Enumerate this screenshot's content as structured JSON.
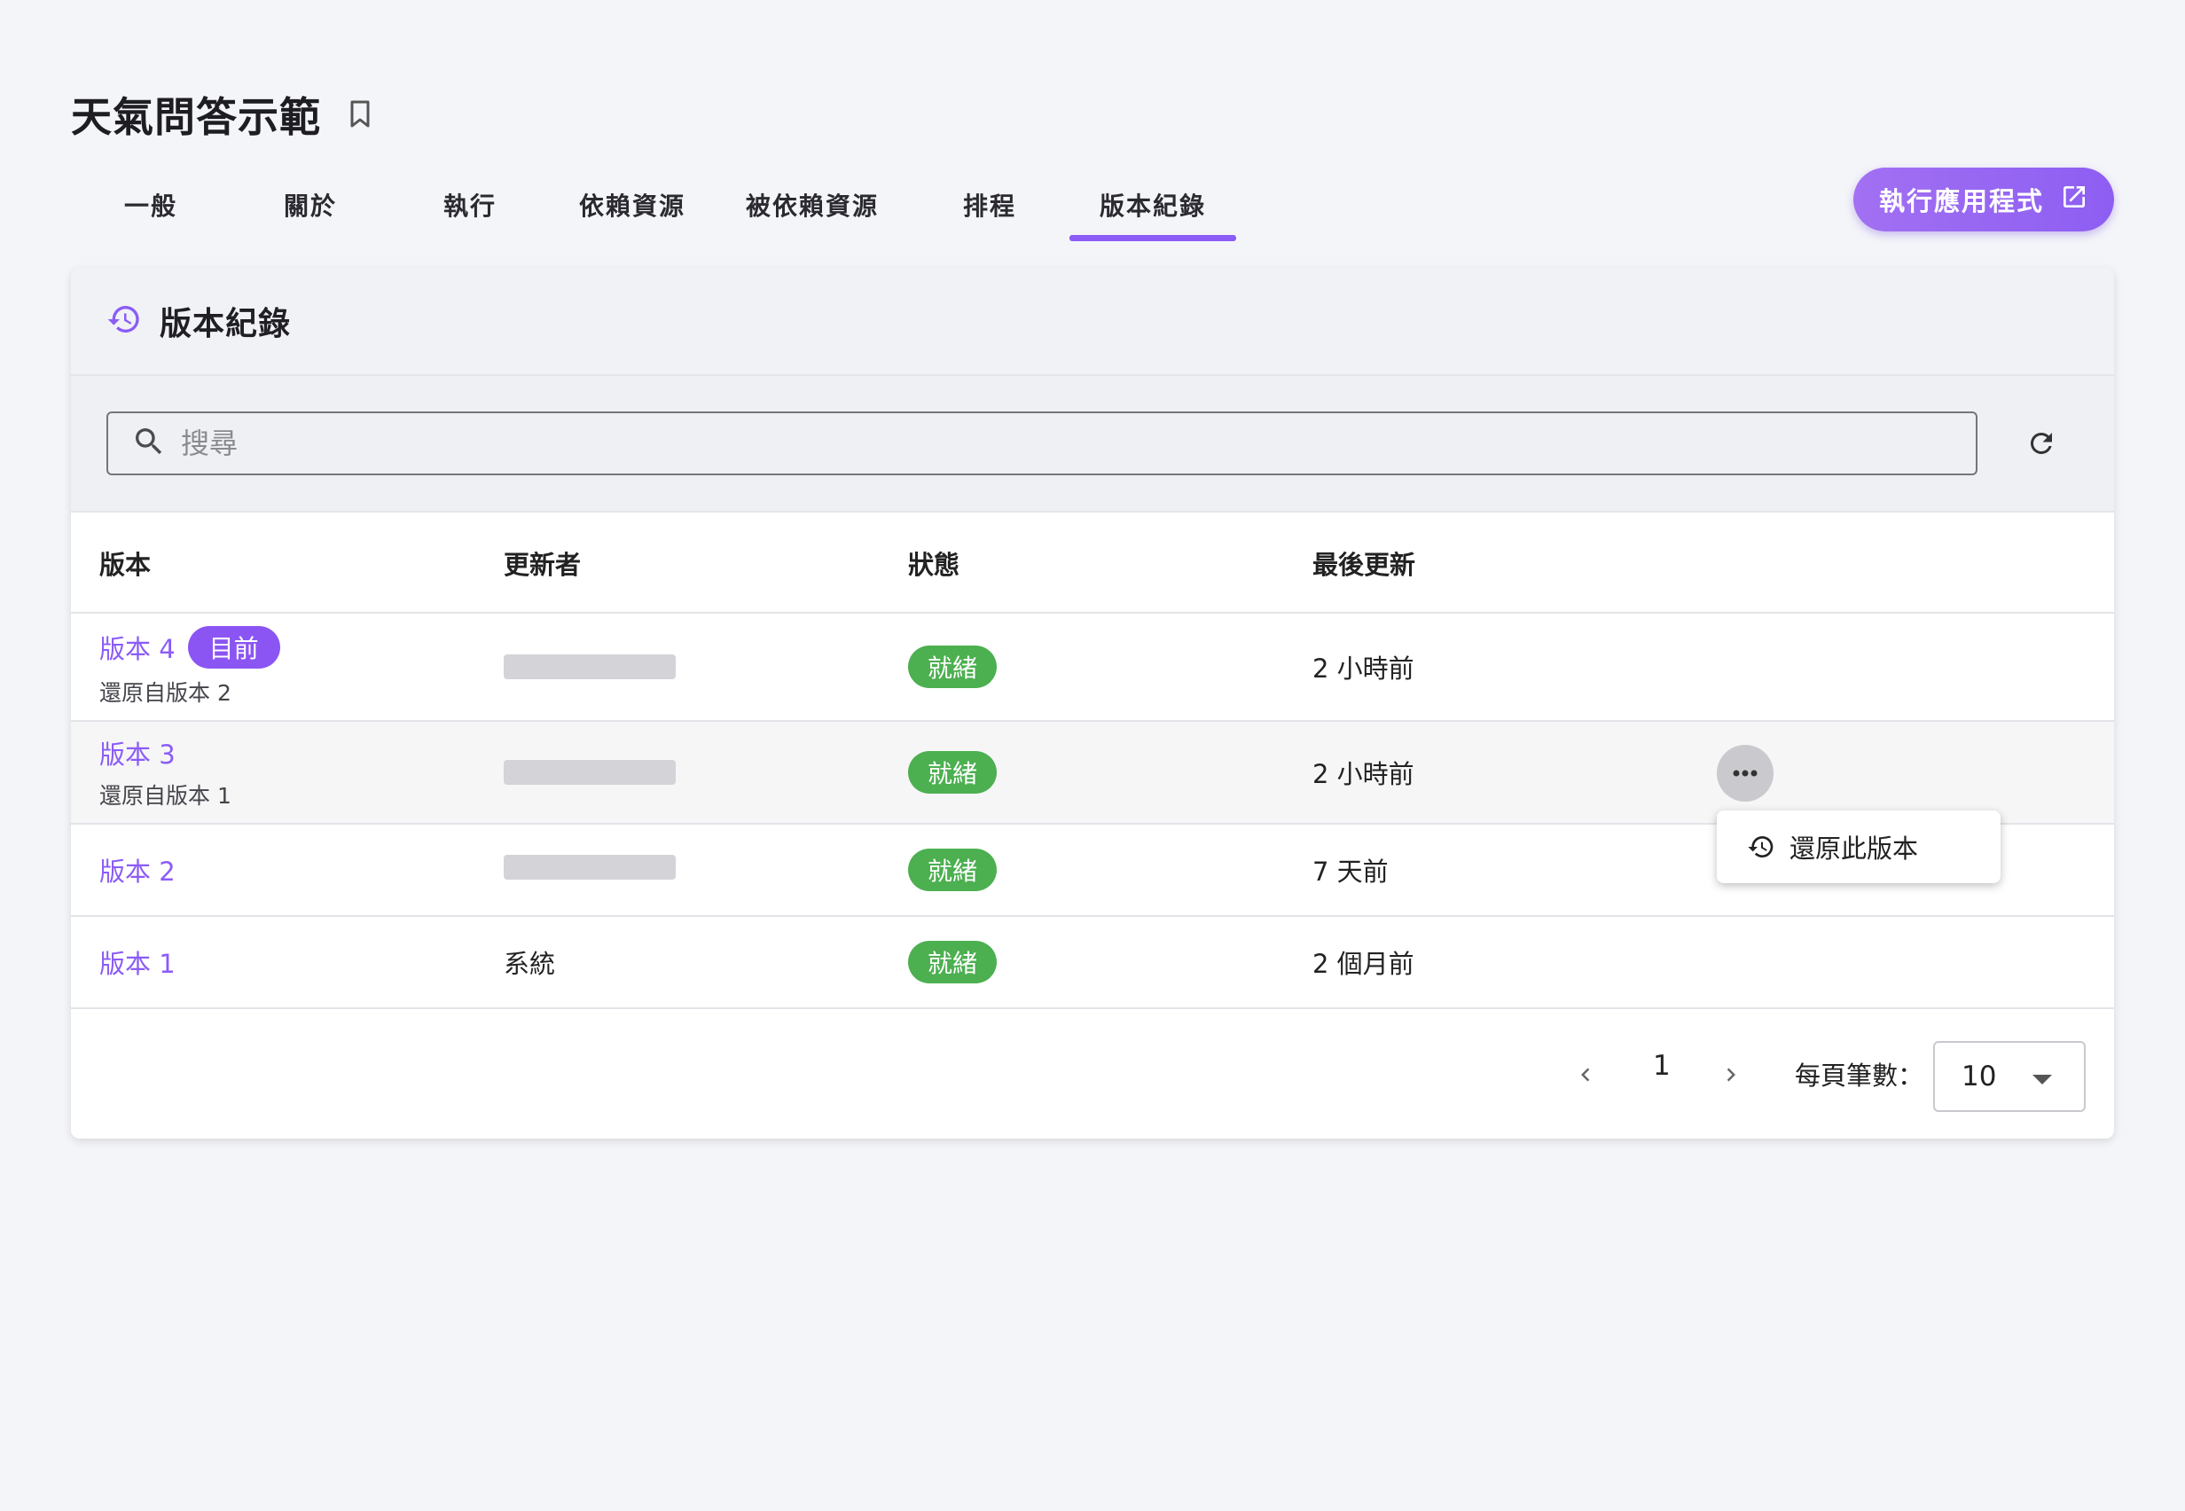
{
  "app": {
    "title": "天氣問答示範"
  },
  "tabs": [
    {
      "label": "一般"
    },
    {
      "label": "關於"
    },
    {
      "label": "執行"
    },
    {
      "label": "依賴資源"
    },
    {
      "label": "被依賴資源"
    },
    {
      "label": "排程"
    },
    {
      "label": "版本紀錄",
      "active": true
    }
  ],
  "run_button": {
    "label": "執行應用程式"
  },
  "card": {
    "title": "版本紀錄"
  },
  "search": {
    "placeholder": "搜尋",
    "value": ""
  },
  "table": {
    "headers": {
      "version": "版本",
      "updater": "更新者",
      "status": "狀態",
      "updated": "最後更新"
    },
    "rows": [
      {
        "version": "版本 4",
        "badge": "目前",
        "sub": "還原自版本 2",
        "updater": "",
        "status": "就緒",
        "updated": "2 小時前"
      },
      {
        "version": "版本 3",
        "sub": "還原自版本 1",
        "updater": "",
        "status": "就緒",
        "updated": "2 小時前"
      },
      {
        "version": "版本 2",
        "updater": "",
        "status": "就緒",
        "updated": "7 天前"
      },
      {
        "version": "版本 1",
        "updater": "系統",
        "status": "就緒",
        "updated": "2 個月前"
      }
    ]
  },
  "row_menu": {
    "restore_label": "還原此版本"
  },
  "pagination": {
    "page": "1",
    "per_page_label": "每頁筆數：",
    "per_page": "10"
  },
  "colors": {
    "accent": "#8b5cf6",
    "ready": "#4caf50"
  }
}
